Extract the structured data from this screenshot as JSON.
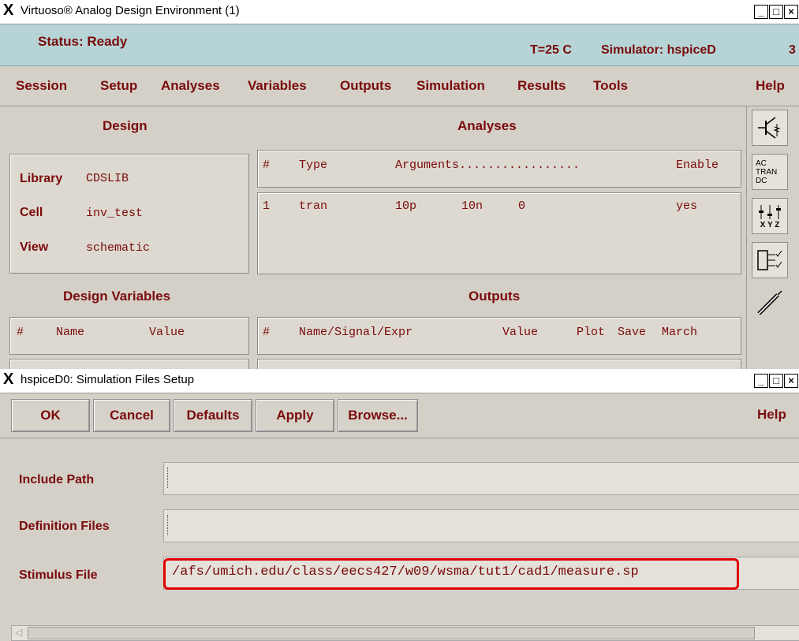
{
  "main_window": {
    "title": "Virtuoso® Analog Design Environment (1)",
    "status": "Status: Ready",
    "temperature": "T=25 C",
    "simulator": "Simulator: hspiceD",
    "session_number": "3",
    "menu": [
      "Session",
      "Setup",
      "Analyses",
      "Variables",
      "Outputs",
      "Simulation",
      "Results",
      "Tools"
    ],
    "help": "Help",
    "design": {
      "heading": "Design",
      "library_label": "Library",
      "library_value": "CDSLIB",
      "cell_label": "Cell",
      "cell_value": "inv_test",
      "view_label": "View",
      "view_value": "schematic"
    },
    "analyses": {
      "heading": "Analyses",
      "col_num": "#",
      "col_type": "Type",
      "col_args": "Arguments.................",
      "col_enable": "Enable",
      "row": {
        "num": "1",
        "type": "tran",
        "arg1": "10p",
        "arg2": "10n",
        "arg3": "0",
        "enable": "yes"
      }
    },
    "design_variables": {
      "heading": "Design Variables",
      "col_num": "#",
      "col_name": "Name",
      "col_value": "Value"
    },
    "outputs": {
      "heading": "Outputs",
      "col_num": "#",
      "col_name": "Name/Signal/Expr",
      "col_value": "Value",
      "col_plot": "Plot",
      "col_save": "Save",
      "col_march": "March"
    },
    "toolbar_labels": {
      "ac": "AC",
      "tran": "TRAN",
      "dc": "DC",
      "xyz": "X Y Z"
    }
  },
  "dialog": {
    "title": "hspiceD0: Simulation Files Setup",
    "buttons": {
      "ok": "OK",
      "cancel": "Cancel",
      "defaults": "Defaults",
      "apply": "Apply",
      "browse": "Browse..."
    },
    "help": "Help",
    "include_path_label": "Include Path",
    "include_path_value": "",
    "definition_files_label": "Definition Files",
    "definition_files_value": "",
    "stimulus_file_label": "Stimulus File",
    "stimulus_file_value": "/afs/umich.edu/class/eecs427/w09/wsma/tut1/cad1/measure.sp",
    "highlight_color": "#e00000"
  }
}
